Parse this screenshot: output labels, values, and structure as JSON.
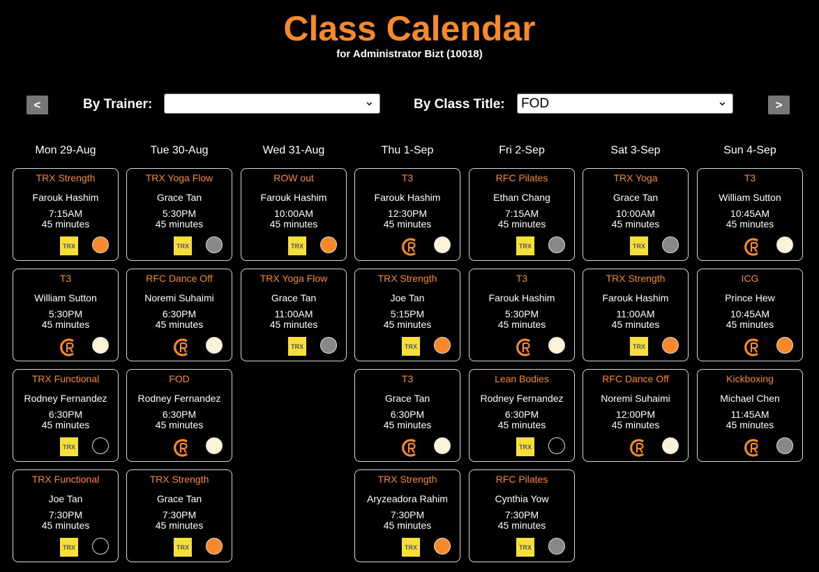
{
  "header": {
    "title": "Class Calendar",
    "subtitle": "for Administrator Bizt (10018)"
  },
  "nav": {
    "prev_label": "<",
    "next_label": ">"
  },
  "filters": {
    "trainer_label": "By Trainer:",
    "trainer_value": "",
    "class_label": "By Class Title:",
    "class_value": "FOD"
  },
  "colors": {
    "accent": "#f7892a",
    "trx_yellow": "#f7df3a",
    "status_orange": "#f7892a",
    "status_grey": "#888888",
    "status_cream": "#fbf3d8",
    "status_black": "#000000"
  },
  "days": [
    {
      "label": "Mon 29-Aug",
      "classes": [
        {
          "title": "TRX Strength",
          "trainer": "Farouk Hashim",
          "time": "7:15AM",
          "duration": "45 minutes",
          "logo": "trx",
          "status": "orange"
        },
        {
          "title": "T3",
          "trainer": "William Sutton",
          "time": "5:30PM",
          "duration": "45 minutes",
          "logo": "c",
          "status": "cream"
        },
        {
          "title": "TRX Functional",
          "trainer": "Rodney Fernandez",
          "time": "6:30PM",
          "duration": "45 minutes",
          "logo": "trx",
          "status": "black"
        },
        {
          "title": "TRX Functional",
          "trainer": "Joe Tan",
          "time": "7:30PM",
          "duration": "45 minutes",
          "logo": "trx",
          "status": "black"
        }
      ]
    },
    {
      "label": "Tue 30-Aug",
      "classes": [
        {
          "title": "TRX Yoga Flow",
          "trainer": "Grace Tan",
          "time": "5:30PM",
          "duration": "45 minutes",
          "logo": "trx",
          "status": "grey"
        },
        {
          "title": "RFC Dance Off",
          "trainer": "Noremi Suhaimi",
          "time": "6:30PM",
          "duration": "45 minutes",
          "logo": "c",
          "status": "cream"
        },
        {
          "title": "FOD",
          "trainer": "Rodney Fernandez",
          "time": "6:30PM",
          "duration": "45 minutes",
          "logo": "c",
          "status": "cream"
        },
        {
          "title": "TRX Strength",
          "trainer": "Grace Tan",
          "time": "7:30PM",
          "duration": "45 minutes",
          "logo": "trx",
          "status": "orange"
        }
      ]
    },
    {
      "label": "Wed 31-Aug",
      "classes": [
        {
          "title": "ROW out",
          "trainer": "Farouk Hashim",
          "time": "10:00AM",
          "duration": "45 minutes",
          "logo": "trx",
          "status": "orange"
        },
        {
          "title": "TRX Yoga Flow",
          "trainer": "Grace Tan",
          "time": "11:00AM",
          "duration": "45 minutes",
          "logo": "trx",
          "status": "grey"
        }
      ]
    },
    {
      "label": "Thu 1-Sep",
      "classes": [
        {
          "title": "T3",
          "trainer": "Farouk Hashim",
          "time": "12:30PM",
          "duration": "45 minutes",
          "logo": "c",
          "status": "cream"
        },
        {
          "title": "TRX Strength",
          "trainer": "Joe Tan",
          "time": "5:15PM",
          "duration": "45 minutes",
          "logo": "trx",
          "status": "orange"
        },
        {
          "title": "T3",
          "trainer": "Grace Tan",
          "time": "6:30PM",
          "duration": "45 minutes",
          "logo": "c",
          "status": "cream"
        },
        {
          "title": "TRX Strength",
          "trainer": "Aryzeadora Rahim",
          "time": "7:30PM",
          "duration": "45 minutes",
          "logo": "trx",
          "status": "orange"
        }
      ]
    },
    {
      "label": "Fri 2-Sep",
      "classes": [
        {
          "title": "RFC Pilates",
          "trainer": "Ethan Chang",
          "time": "7:15AM",
          "duration": "45 minutes",
          "logo": "trx",
          "status": "grey"
        },
        {
          "title": "T3",
          "trainer": "Farouk Hashim",
          "time": "5:30PM",
          "duration": "45 minutes",
          "logo": "c",
          "status": "cream"
        },
        {
          "title": "Lean Bodies",
          "trainer": "Rodney Fernandez",
          "time": "6:30PM",
          "duration": "45 minutes",
          "logo": "trx",
          "status": "black"
        },
        {
          "title": "RFC Pilates",
          "trainer": "Cynthia Yow",
          "time": "7:30PM",
          "duration": "45 minutes",
          "logo": "trx",
          "status": "grey"
        }
      ]
    },
    {
      "label": "Sat 3-Sep",
      "classes": [
        {
          "title": "TRX Yoga",
          "trainer": "Grace Tan",
          "time": "10:00AM",
          "duration": "45 minutes",
          "logo": "trx",
          "status": "grey"
        },
        {
          "title": "TRX Strength",
          "trainer": "Farouk Hashim",
          "time": "11:00AM",
          "duration": "45 minutes",
          "logo": "trx",
          "status": "orange"
        },
        {
          "title": "RFC Dance Off",
          "trainer": "Noremi Suhaimi",
          "time": "12:00PM",
          "duration": "45 minutes",
          "logo": "c",
          "status": "cream"
        }
      ]
    },
    {
      "label": "Sun 4-Sep",
      "classes": [
        {
          "title": "T3",
          "trainer": "William Sutton",
          "time": "10:45AM",
          "duration": "45 minutes",
          "logo": "c",
          "status": "cream"
        },
        {
          "title": "ICG",
          "trainer": "Prince Hew",
          "time": "10:45AM",
          "duration": "45 minutes",
          "logo": "c",
          "status": "orange"
        },
        {
          "title": "Kickboxing",
          "trainer": "Michael Chen",
          "time": "11:45AM",
          "duration": "45 minutes",
          "logo": "c",
          "status": "grey"
        }
      ]
    }
  ],
  "trx_logo_text": "TRX"
}
